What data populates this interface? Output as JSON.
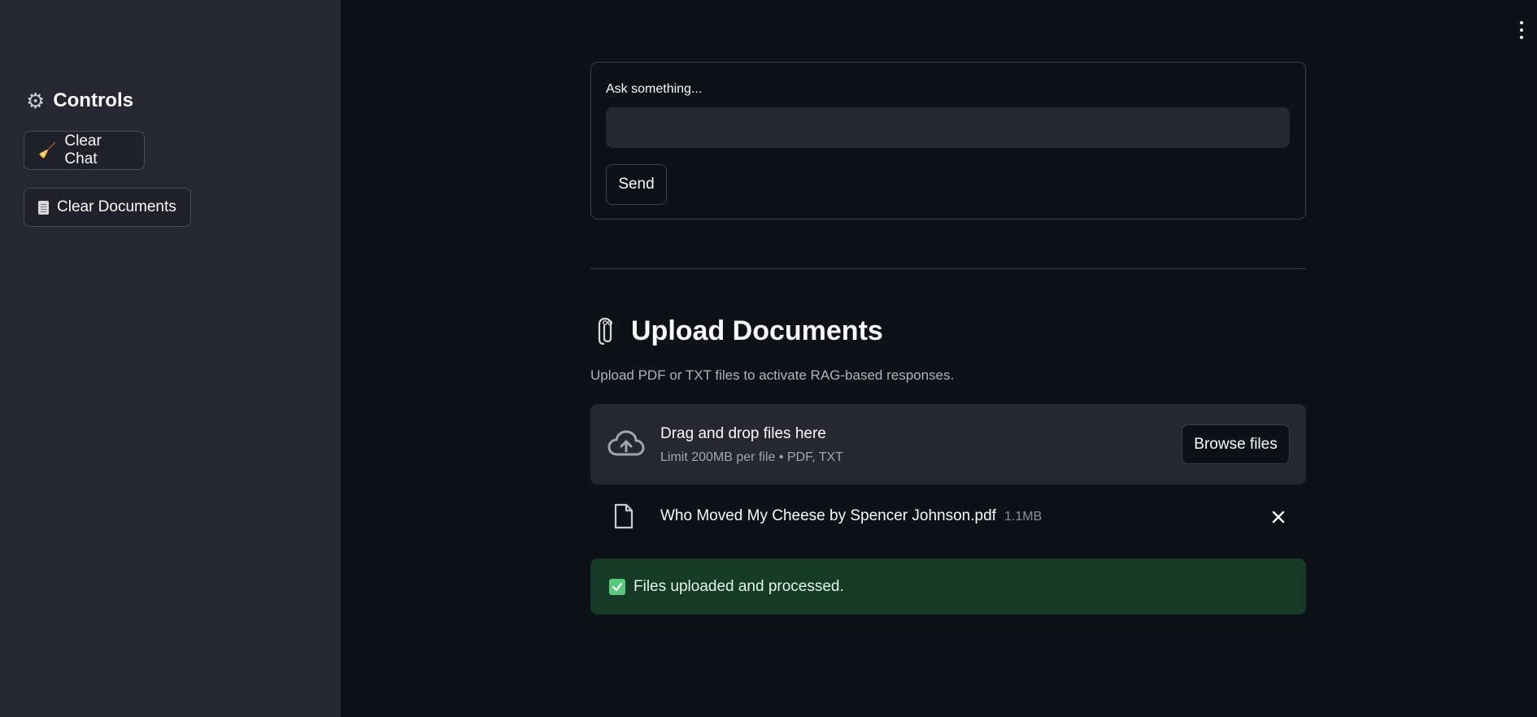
{
  "sidebar": {
    "heading": "Controls",
    "heading_icon": "gear-icon",
    "buttons": [
      {
        "label": "Clear Chat",
        "icon": "broom-icon"
      },
      {
        "label": "Clear Documents",
        "icon": "document-icon"
      }
    ]
  },
  "form": {
    "ask_label": "Ask something...",
    "ask_value": "",
    "send_label": "Send"
  },
  "upload": {
    "heading": "Upload Documents",
    "heading_icon": "paperclip-icon",
    "caption": "Upload PDF or TXT files to activate RAG-based responses.",
    "dropzone_title": "Drag and drop files here",
    "dropzone_limit": "Limit 200MB per file • PDF, TXT",
    "browse_label": "Browse files",
    "files": [
      {
        "name": "Who Moved My Cheese by Spencer Johnson.pdf",
        "size": "1.1MB"
      }
    ]
  },
  "status": {
    "success_message": "Files uploaded and processed.",
    "success_color": "#173928"
  },
  "colors": {
    "background": "#0e1117",
    "sidebar": "#262730",
    "text": "#fafafa"
  }
}
